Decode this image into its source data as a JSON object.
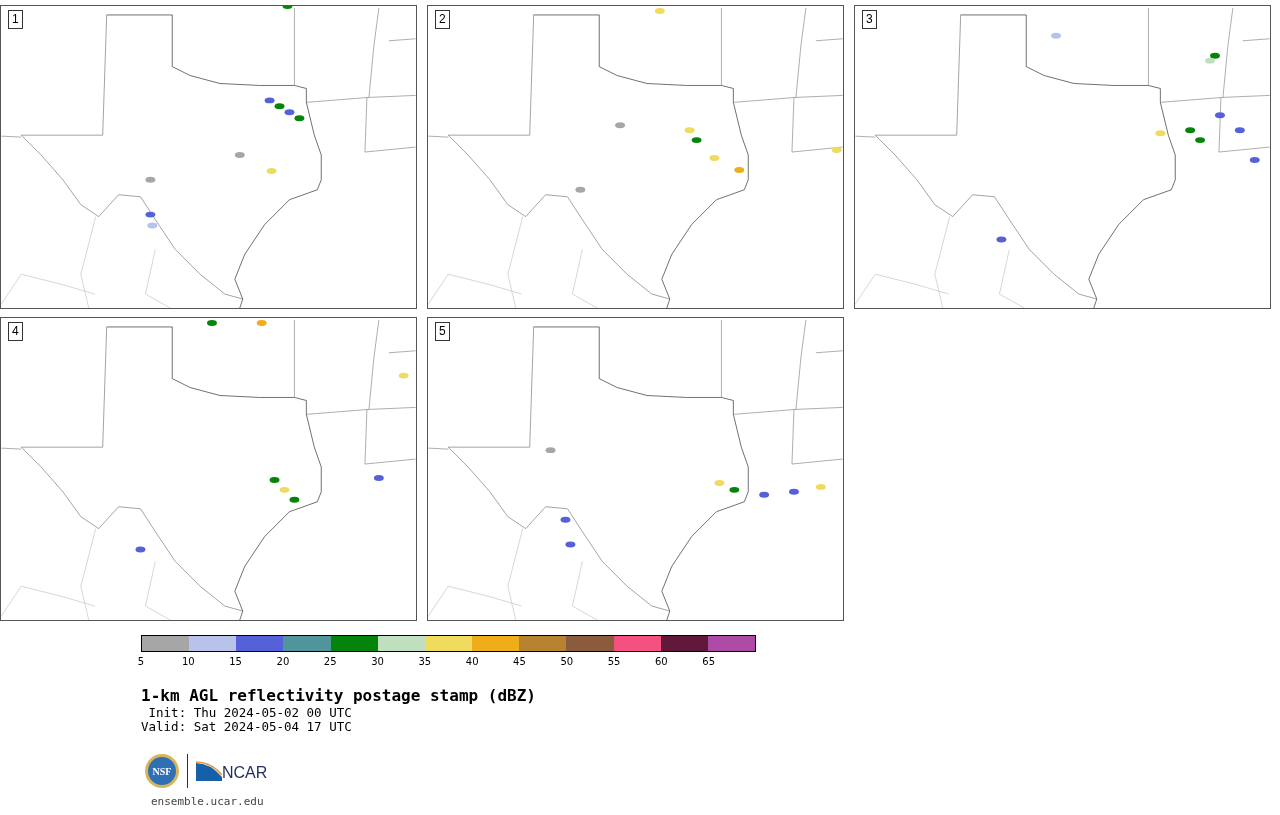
{
  "panels": [
    {
      "label": "1"
    },
    {
      "label": "2"
    },
    {
      "label": "3"
    },
    {
      "label": "4"
    },
    {
      "label": "5"
    }
  ],
  "colorbar": {
    "swatches": [
      {
        "color": "#a6a6a6"
      },
      {
        "color": "#b8c3ec"
      },
      {
        "color": "#5461d9"
      },
      {
        "color": "#4f959b"
      },
      {
        "color": "#04840a"
      },
      {
        "color": "#bfdfbe"
      },
      {
        "color": "#efdb5e"
      },
      {
        "color": "#efad1a"
      },
      {
        "color": "#b88330"
      },
      {
        "color": "#8b5b3e"
      },
      {
        "color": "#f45180"
      },
      {
        "color": "#62183a"
      },
      {
        "color": "#ad4aa6"
      }
    ],
    "ticks": [
      "5",
      "10",
      "15",
      "20",
      "25",
      "30",
      "35",
      "40",
      "45",
      "50",
      "55",
      "60",
      "65"
    ]
  },
  "title": "1-km AGL reflectivity postage stamp (dBZ)",
  "init": " Init: Thu 2024-05-02 00 UTC",
  "valid": "Valid: Sat 2024-05-04 17 UTC",
  "logos": {
    "nsf": "NSF",
    "ncar": "NCAR"
  },
  "url": "ensemble.ucar.edu"
}
